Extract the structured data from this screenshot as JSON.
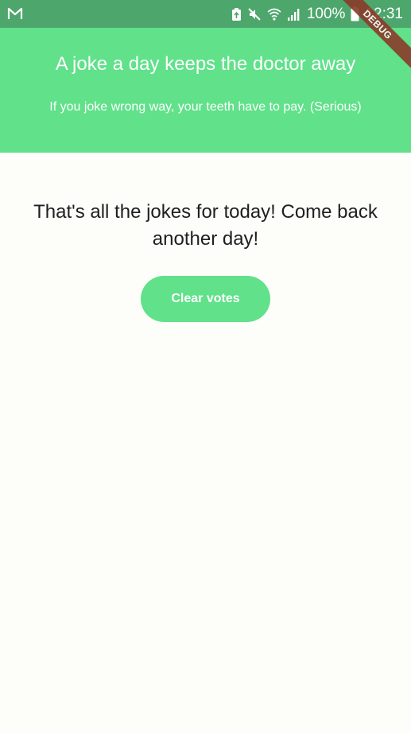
{
  "status_bar": {
    "left_icon": "gmail-icon",
    "right_icons": [
      "battery-saver-icon",
      "mute-icon",
      "wifi-icon",
      "signal-icon",
      "battery-icon"
    ],
    "battery_percent": "100%",
    "time": "12:31"
  },
  "header": {
    "title": "A joke a day keeps the doctor away",
    "subtitle": "If you joke wrong way, your teeth have to pay. (Serious)"
  },
  "main": {
    "message": "That's all the jokes for today! Come back another day!",
    "clear_button_label": "Clear votes"
  },
  "debug_banner": {
    "label": "DEBUG"
  },
  "colors": {
    "status_bar": "#4DA66C",
    "accent_green": "#60E18A",
    "background": "#FDFEF9",
    "debug_ribbon": "#8A3B2A"
  }
}
